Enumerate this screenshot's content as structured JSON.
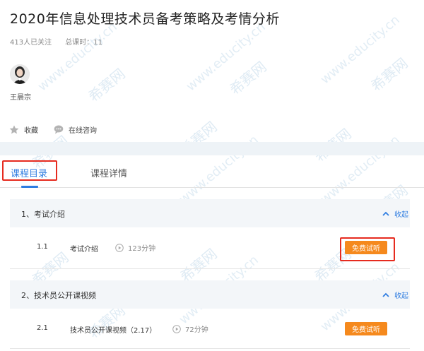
{
  "course": {
    "title": "2020年信息处理技术员备考策略及考情分析",
    "followers": "413人已关注",
    "total_lessons": "总课时：11"
  },
  "teacher": {
    "name": "王晨宗"
  },
  "actions": {
    "favorite": "收藏",
    "consult": "在线咨询"
  },
  "tabs": [
    {
      "label": "课程目录"
    },
    {
      "label": "课程详情"
    }
  ],
  "chapters": [
    {
      "title": "1、考试介绍",
      "collapse_label": "收起",
      "lessons": [
        {
          "num": "1.1",
          "title": "考试介绍",
          "duration": "123分钟",
          "button": "免费试听"
        }
      ]
    },
    {
      "title": "2、技术员公开课视频",
      "collapse_label": "收起",
      "lessons": [
        {
          "num": "2.1",
          "title": "技术员公开课视频（2.17）",
          "duration": "72分钟",
          "button": "免费试听"
        }
      ]
    }
  ],
  "watermark": {
    "site": "www.educity.cn",
    "brand": "希赛网"
  },
  "colors": {
    "accent": "#2f7de1",
    "button": "#f5891d",
    "highlight": "#e62b1f"
  }
}
